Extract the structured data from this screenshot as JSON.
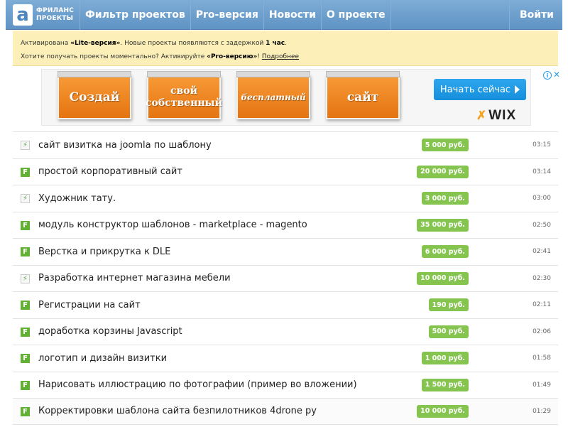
{
  "header": {
    "logo_letter": "a",
    "logo_line1": "ФРИЛАНС",
    "logo_line2": "ПРОЕКТЫ",
    "nav": [
      "Фильтр проектов",
      "Pro-версия",
      "Новости",
      "О проекте"
    ],
    "login": "Войти"
  },
  "notice": {
    "l1_pre": "Активирована ",
    "l1_bold": "«Lite-версия»",
    "l1_mid": ". Новые проекты появляются с задержкой ",
    "l1_bold2": "1 час",
    "l1_end": ".",
    "l2_pre": "Хотите получать проекты моментально? Активируйте ",
    "l2_bold": "«Pro-версию»",
    "l2_mid": "! ",
    "l2_link": "Подробнее"
  },
  "ad": {
    "cards": [
      "Создай",
      "свой собственный",
      "бесплатный",
      "сайт"
    ],
    "button_label": "Начать сейчас",
    "brand": "WIX",
    "info": "i",
    "close": "✕"
  },
  "projects": [
    {
      "icon": "weblancer-icon",
      "title": "сайт визитка на joomla по шаблону",
      "price": "5 000 руб.",
      "time": "03:15"
    },
    {
      "icon": "fl-icon",
      "title": "простой корпоративный сайт",
      "price": "20 000 руб.",
      "time": "03:14"
    },
    {
      "icon": "weblancer-icon",
      "title": "Художник тату.",
      "price": "3 000 руб.",
      "time": "03:00"
    },
    {
      "icon": "fl-icon",
      "title": "модуль конструктор шаблонов - marketplace - magento",
      "price": "35 000 руб.",
      "time": "02:50"
    },
    {
      "icon": "fl-icon",
      "title": "Верстка и прикрутка к DLE",
      "price": "6 000 руб.",
      "time": "02:41"
    },
    {
      "icon": "weblancer-icon",
      "title": "Разработка интернет магазина мебели",
      "price": "10 000 руб.",
      "time": "02:30"
    },
    {
      "icon": "fl-icon",
      "title": "Регистрации на сайт",
      "price": "190 руб.",
      "time": "02:11"
    },
    {
      "icon": "fl-icon",
      "title": "доработка корзины Javascript",
      "price": "500 руб.",
      "time": "02:06"
    },
    {
      "icon": "fl-icon",
      "title": "логотип и дизайн визитки",
      "price": "1 000 руб.",
      "time": "01:58"
    },
    {
      "icon": "fl-icon",
      "title": "Нарисовать иллюстрацию по фотографии (пример во вложении)",
      "price": "1 500 руб.",
      "time": "01:49"
    },
    {
      "icon": "fl-icon",
      "title": "Корректировки шаблона сайта безпилотников 4drone ру",
      "price": "10 000 руб.",
      "time": "01:29"
    }
  ],
  "colors": {
    "navbar": "#6a9ccb",
    "notice_bg": "#fcf0b8",
    "price_badge": "#84c44f",
    "ad_orange": "#ee8524",
    "ad_button": "#1e9ae6"
  }
}
